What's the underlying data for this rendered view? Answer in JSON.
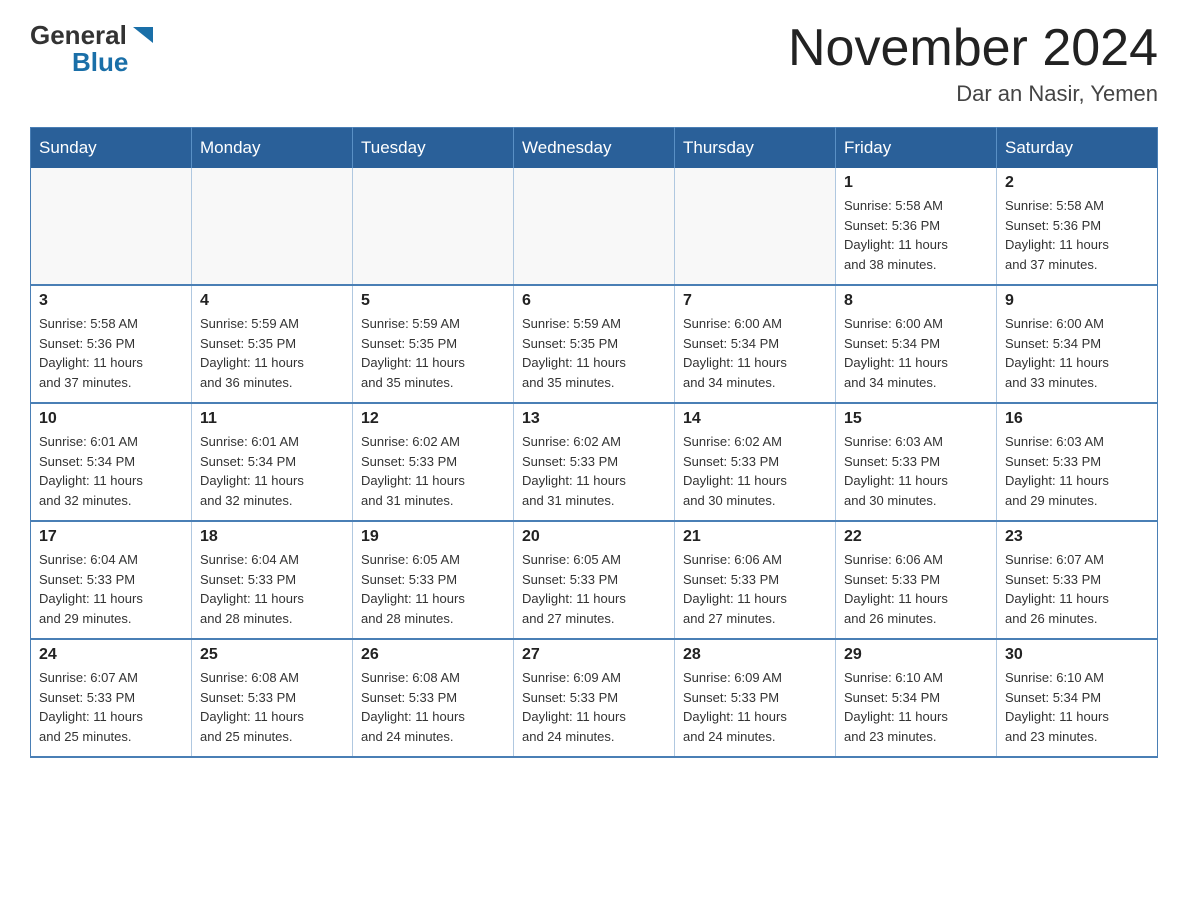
{
  "header": {
    "logo_general": "General",
    "logo_blue": "Blue",
    "title": "November 2024",
    "subtitle": "Dar an Nasir, Yemen"
  },
  "weekdays": [
    "Sunday",
    "Monday",
    "Tuesday",
    "Wednesday",
    "Thursday",
    "Friday",
    "Saturday"
  ],
  "weeks": [
    [
      {
        "day": "",
        "info": ""
      },
      {
        "day": "",
        "info": ""
      },
      {
        "day": "",
        "info": ""
      },
      {
        "day": "",
        "info": ""
      },
      {
        "day": "",
        "info": ""
      },
      {
        "day": "1",
        "info": "Sunrise: 5:58 AM\nSunset: 5:36 PM\nDaylight: 11 hours\nand 38 minutes."
      },
      {
        "day": "2",
        "info": "Sunrise: 5:58 AM\nSunset: 5:36 PM\nDaylight: 11 hours\nand 37 minutes."
      }
    ],
    [
      {
        "day": "3",
        "info": "Sunrise: 5:58 AM\nSunset: 5:36 PM\nDaylight: 11 hours\nand 37 minutes."
      },
      {
        "day": "4",
        "info": "Sunrise: 5:59 AM\nSunset: 5:35 PM\nDaylight: 11 hours\nand 36 minutes."
      },
      {
        "day": "5",
        "info": "Sunrise: 5:59 AM\nSunset: 5:35 PM\nDaylight: 11 hours\nand 35 minutes."
      },
      {
        "day": "6",
        "info": "Sunrise: 5:59 AM\nSunset: 5:35 PM\nDaylight: 11 hours\nand 35 minutes."
      },
      {
        "day": "7",
        "info": "Sunrise: 6:00 AM\nSunset: 5:34 PM\nDaylight: 11 hours\nand 34 minutes."
      },
      {
        "day": "8",
        "info": "Sunrise: 6:00 AM\nSunset: 5:34 PM\nDaylight: 11 hours\nand 34 minutes."
      },
      {
        "day": "9",
        "info": "Sunrise: 6:00 AM\nSunset: 5:34 PM\nDaylight: 11 hours\nand 33 minutes."
      }
    ],
    [
      {
        "day": "10",
        "info": "Sunrise: 6:01 AM\nSunset: 5:34 PM\nDaylight: 11 hours\nand 32 minutes."
      },
      {
        "day": "11",
        "info": "Sunrise: 6:01 AM\nSunset: 5:34 PM\nDaylight: 11 hours\nand 32 minutes."
      },
      {
        "day": "12",
        "info": "Sunrise: 6:02 AM\nSunset: 5:33 PM\nDaylight: 11 hours\nand 31 minutes."
      },
      {
        "day": "13",
        "info": "Sunrise: 6:02 AM\nSunset: 5:33 PM\nDaylight: 11 hours\nand 31 minutes."
      },
      {
        "day": "14",
        "info": "Sunrise: 6:02 AM\nSunset: 5:33 PM\nDaylight: 11 hours\nand 30 minutes."
      },
      {
        "day": "15",
        "info": "Sunrise: 6:03 AM\nSunset: 5:33 PM\nDaylight: 11 hours\nand 30 minutes."
      },
      {
        "day": "16",
        "info": "Sunrise: 6:03 AM\nSunset: 5:33 PM\nDaylight: 11 hours\nand 29 minutes."
      }
    ],
    [
      {
        "day": "17",
        "info": "Sunrise: 6:04 AM\nSunset: 5:33 PM\nDaylight: 11 hours\nand 29 minutes."
      },
      {
        "day": "18",
        "info": "Sunrise: 6:04 AM\nSunset: 5:33 PM\nDaylight: 11 hours\nand 28 minutes."
      },
      {
        "day": "19",
        "info": "Sunrise: 6:05 AM\nSunset: 5:33 PM\nDaylight: 11 hours\nand 28 minutes."
      },
      {
        "day": "20",
        "info": "Sunrise: 6:05 AM\nSunset: 5:33 PM\nDaylight: 11 hours\nand 27 minutes."
      },
      {
        "day": "21",
        "info": "Sunrise: 6:06 AM\nSunset: 5:33 PM\nDaylight: 11 hours\nand 27 minutes."
      },
      {
        "day": "22",
        "info": "Sunrise: 6:06 AM\nSunset: 5:33 PM\nDaylight: 11 hours\nand 26 minutes."
      },
      {
        "day": "23",
        "info": "Sunrise: 6:07 AM\nSunset: 5:33 PM\nDaylight: 11 hours\nand 26 minutes."
      }
    ],
    [
      {
        "day": "24",
        "info": "Sunrise: 6:07 AM\nSunset: 5:33 PM\nDaylight: 11 hours\nand 25 minutes."
      },
      {
        "day": "25",
        "info": "Sunrise: 6:08 AM\nSunset: 5:33 PM\nDaylight: 11 hours\nand 25 minutes."
      },
      {
        "day": "26",
        "info": "Sunrise: 6:08 AM\nSunset: 5:33 PM\nDaylight: 11 hours\nand 24 minutes."
      },
      {
        "day": "27",
        "info": "Sunrise: 6:09 AM\nSunset: 5:33 PM\nDaylight: 11 hours\nand 24 minutes."
      },
      {
        "day": "28",
        "info": "Sunrise: 6:09 AM\nSunset: 5:33 PM\nDaylight: 11 hours\nand 24 minutes."
      },
      {
        "day": "29",
        "info": "Sunrise: 6:10 AM\nSunset: 5:34 PM\nDaylight: 11 hours\nand 23 minutes."
      },
      {
        "day": "30",
        "info": "Sunrise: 6:10 AM\nSunset: 5:34 PM\nDaylight: 11 hours\nand 23 minutes."
      }
    ]
  ]
}
